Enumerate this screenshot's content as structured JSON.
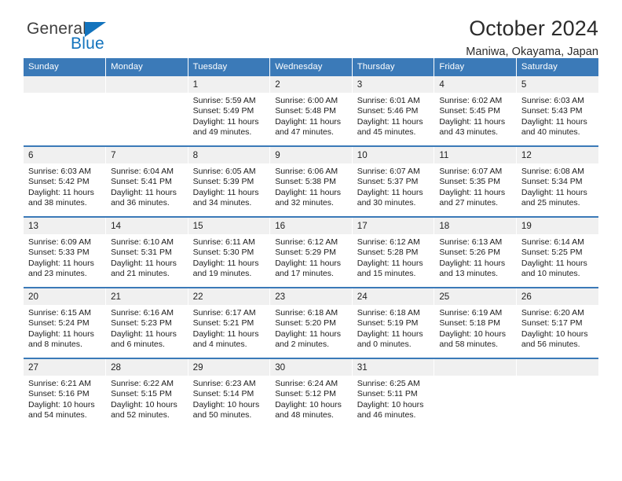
{
  "brand": {
    "name_top": "General",
    "name_bottom": "Blue",
    "logo_icon": "blue-triangle-icon",
    "color_blue": "#1273bd",
    "color_text": "#3f3f3f"
  },
  "header": {
    "title": "October 2024",
    "subtitle": "Maniwa, Okayama, Japan"
  },
  "theme": {
    "header_blue": "#3b7ab8",
    "daynum_band": "#f0f0f0",
    "divider_blue": "#3b7ab8"
  },
  "calendar": {
    "weekday_headers": [
      "Sunday",
      "Monday",
      "Tuesday",
      "Wednesday",
      "Thursday",
      "Friday",
      "Saturday"
    ],
    "weeks": [
      [
        {
          "day": "",
          "empty": true,
          "line1": "",
          "line2": "",
          "line3": "",
          "line4": ""
        },
        {
          "day": "",
          "empty": true,
          "line1": "",
          "line2": "",
          "line3": "",
          "line4": ""
        },
        {
          "day": "1",
          "empty": false,
          "line1": "Sunrise: 5:59 AM",
          "line2": "Sunset: 5:49 PM",
          "line3": "Daylight: 11 hours",
          "line4": "and 49 minutes."
        },
        {
          "day": "2",
          "empty": false,
          "line1": "Sunrise: 6:00 AM",
          "line2": "Sunset: 5:48 PM",
          "line3": "Daylight: 11 hours",
          "line4": "and 47 minutes."
        },
        {
          "day": "3",
          "empty": false,
          "line1": "Sunrise: 6:01 AM",
          "line2": "Sunset: 5:46 PM",
          "line3": "Daylight: 11 hours",
          "line4": "and 45 minutes."
        },
        {
          "day": "4",
          "empty": false,
          "line1": "Sunrise: 6:02 AM",
          "line2": "Sunset: 5:45 PM",
          "line3": "Daylight: 11 hours",
          "line4": "and 43 minutes."
        },
        {
          "day": "5",
          "empty": false,
          "line1": "Sunrise: 6:03 AM",
          "line2": "Sunset: 5:43 PM",
          "line3": "Daylight: 11 hours",
          "line4": "and 40 minutes."
        }
      ],
      [
        {
          "day": "6",
          "empty": false,
          "line1": "Sunrise: 6:03 AM",
          "line2": "Sunset: 5:42 PM",
          "line3": "Daylight: 11 hours",
          "line4": "and 38 minutes."
        },
        {
          "day": "7",
          "empty": false,
          "line1": "Sunrise: 6:04 AM",
          "line2": "Sunset: 5:41 PM",
          "line3": "Daylight: 11 hours",
          "line4": "and 36 minutes."
        },
        {
          "day": "8",
          "empty": false,
          "line1": "Sunrise: 6:05 AM",
          "line2": "Sunset: 5:39 PM",
          "line3": "Daylight: 11 hours",
          "line4": "and 34 minutes."
        },
        {
          "day": "9",
          "empty": false,
          "line1": "Sunrise: 6:06 AM",
          "line2": "Sunset: 5:38 PM",
          "line3": "Daylight: 11 hours",
          "line4": "and 32 minutes."
        },
        {
          "day": "10",
          "empty": false,
          "line1": "Sunrise: 6:07 AM",
          "line2": "Sunset: 5:37 PM",
          "line3": "Daylight: 11 hours",
          "line4": "and 30 minutes."
        },
        {
          "day": "11",
          "empty": false,
          "line1": "Sunrise: 6:07 AM",
          "line2": "Sunset: 5:35 PM",
          "line3": "Daylight: 11 hours",
          "line4": "and 27 minutes."
        },
        {
          "day": "12",
          "empty": false,
          "line1": "Sunrise: 6:08 AM",
          "line2": "Sunset: 5:34 PM",
          "line3": "Daylight: 11 hours",
          "line4": "and 25 minutes."
        }
      ],
      [
        {
          "day": "13",
          "empty": false,
          "line1": "Sunrise: 6:09 AM",
          "line2": "Sunset: 5:33 PM",
          "line3": "Daylight: 11 hours",
          "line4": "and 23 minutes."
        },
        {
          "day": "14",
          "empty": false,
          "line1": "Sunrise: 6:10 AM",
          "line2": "Sunset: 5:31 PM",
          "line3": "Daylight: 11 hours",
          "line4": "and 21 minutes."
        },
        {
          "day": "15",
          "empty": false,
          "line1": "Sunrise: 6:11 AM",
          "line2": "Sunset: 5:30 PM",
          "line3": "Daylight: 11 hours",
          "line4": "and 19 minutes."
        },
        {
          "day": "16",
          "empty": false,
          "line1": "Sunrise: 6:12 AM",
          "line2": "Sunset: 5:29 PM",
          "line3": "Daylight: 11 hours",
          "line4": "and 17 minutes."
        },
        {
          "day": "17",
          "empty": false,
          "line1": "Sunrise: 6:12 AM",
          "line2": "Sunset: 5:28 PM",
          "line3": "Daylight: 11 hours",
          "line4": "and 15 minutes."
        },
        {
          "day": "18",
          "empty": false,
          "line1": "Sunrise: 6:13 AM",
          "line2": "Sunset: 5:26 PM",
          "line3": "Daylight: 11 hours",
          "line4": "and 13 minutes."
        },
        {
          "day": "19",
          "empty": false,
          "line1": "Sunrise: 6:14 AM",
          "line2": "Sunset: 5:25 PM",
          "line3": "Daylight: 11 hours",
          "line4": "and 10 minutes."
        }
      ],
      [
        {
          "day": "20",
          "empty": false,
          "line1": "Sunrise: 6:15 AM",
          "line2": "Sunset: 5:24 PM",
          "line3": "Daylight: 11 hours",
          "line4": "and 8 minutes."
        },
        {
          "day": "21",
          "empty": false,
          "line1": "Sunrise: 6:16 AM",
          "line2": "Sunset: 5:23 PM",
          "line3": "Daylight: 11 hours",
          "line4": "and 6 minutes."
        },
        {
          "day": "22",
          "empty": false,
          "line1": "Sunrise: 6:17 AM",
          "line2": "Sunset: 5:21 PM",
          "line3": "Daylight: 11 hours",
          "line4": "and 4 minutes."
        },
        {
          "day": "23",
          "empty": false,
          "line1": "Sunrise: 6:18 AM",
          "line2": "Sunset: 5:20 PM",
          "line3": "Daylight: 11 hours",
          "line4": "and 2 minutes."
        },
        {
          "day": "24",
          "empty": false,
          "line1": "Sunrise: 6:18 AM",
          "line2": "Sunset: 5:19 PM",
          "line3": "Daylight: 11 hours",
          "line4": "and 0 minutes."
        },
        {
          "day": "25",
          "empty": false,
          "line1": "Sunrise: 6:19 AM",
          "line2": "Sunset: 5:18 PM",
          "line3": "Daylight: 10 hours",
          "line4": "and 58 minutes."
        },
        {
          "day": "26",
          "empty": false,
          "line1": "Sunrise: 6:20 AM",
          "line2": "Sunset: 5:17 PM",
          "line3": "Daylight: 10 hours",
          "line4": "and 56 minutes."
        }
      ],
      [
        {
          "day": "27",
          "empty": false,
          "line1": "Sunrise: 6:21 AM",
          "line2": "Sunset: 5:16 PM",
          "line3": "Daylight: 10 hours",
          "line4": "and 54 minutes."
        },
        {
          "day": "28",
          "empty": false,
          "line1": "Sunrise: 6:22 AM",
          "line2": "Sunset: 5:15 PM",
          "line3": "Daylight: 10 hours",
          "line4": "and 52 minutes."
        },
        {
          "day": "29",
          "empty": false,
          "line1": "Sunrise: 6:23 AM",
          "line2": "Sunset: 5:14 PM",
          "line3": "Daylight: 10 hours",
          "line4": "and 50 minutes."
        },
        {
          "day": "30",
          "empty": false,
          "line1": "Sunrise: 6:24 AM",
          "line2": "Sunset: 5:12 PM",
          "line3": "Daylight: 10 hours",
          "line4": "and 48 minutes."
        },
        {
          "day": "31",
          "empty": false,
          "line1": "Sunrise: 6:25 AM",
          "line2": "Sunset: 5:11 PM",
          "line3": "Daylight: 10 hours",
          "line4": "and 46 minutes."
        },
        {
          "day": "",
          "empty": true,
          "line1": "",
          "line2": "",
          "line3": "",
          "line4": ""
        },
        {
          "day": "",
          "empty": true,
          "line1": "",
          "line2": "",
          "line3": "",
          "line4": ""
        }
      ]
    ]
  }
}
